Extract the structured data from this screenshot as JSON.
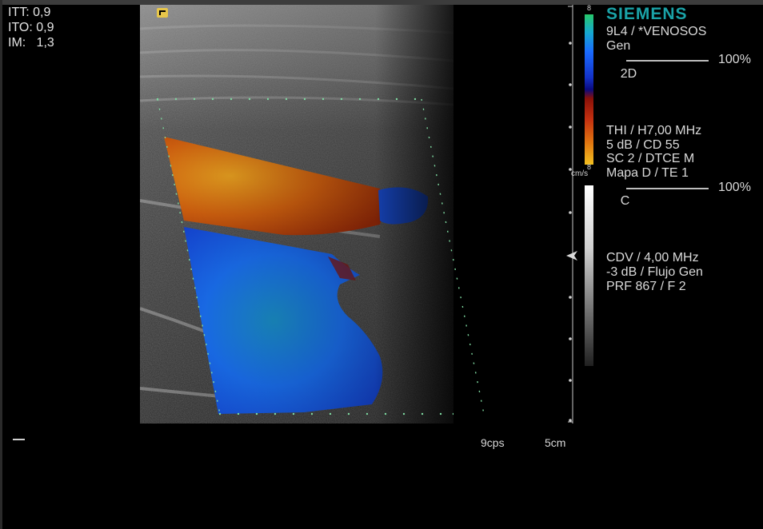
{
  "metrics": {
    "itt": "ITT: 0,9",
    "ito": "ITO: 0,9",
    "im": "IM:   1,3"
  },
  "brand": "SIEMENS",
  "params": {
    "probe": "9L4 / *VENOSOS",
    "preset": "Gen",
    "mode_2d_label": "2D",
    "mode_2d_power": "100%",
    "thi": "THI / H7,00 MHz",
    "db_cd": "5 dB / CD 55",
    "sc_dtce": "SC 2 / DTCE M",
    "mapa_te": "Mapa D / TE 1",
    "mode_c_label": "C",
    "mode_c_power": "100%",
    "cdv": "CDV / 4,00 MHz",
    "flow": "-3 dB / Flujo Gen",
    "prf": "PRF 867 / F 2"
  },
  "colorbar": {
    "top_value": "8",
    "bottom_value": "8",
    "unit": "cm/s"
  },
  "footer": {
    "frame_rate": "9cps",
    "depth": "5cm"
  },
  "colors": {
    "brand": "#1aa3a8",
    "flow_toward": "#d4620e",
    "flow_away": "#1a6ff0",
    "roi_dots": "#7ed9a0"
  },
  "icons": {
    "probe_orientation": "probe-orientation-icon",
    "focus_marker": "focus-arrow-icon"
  }
}
